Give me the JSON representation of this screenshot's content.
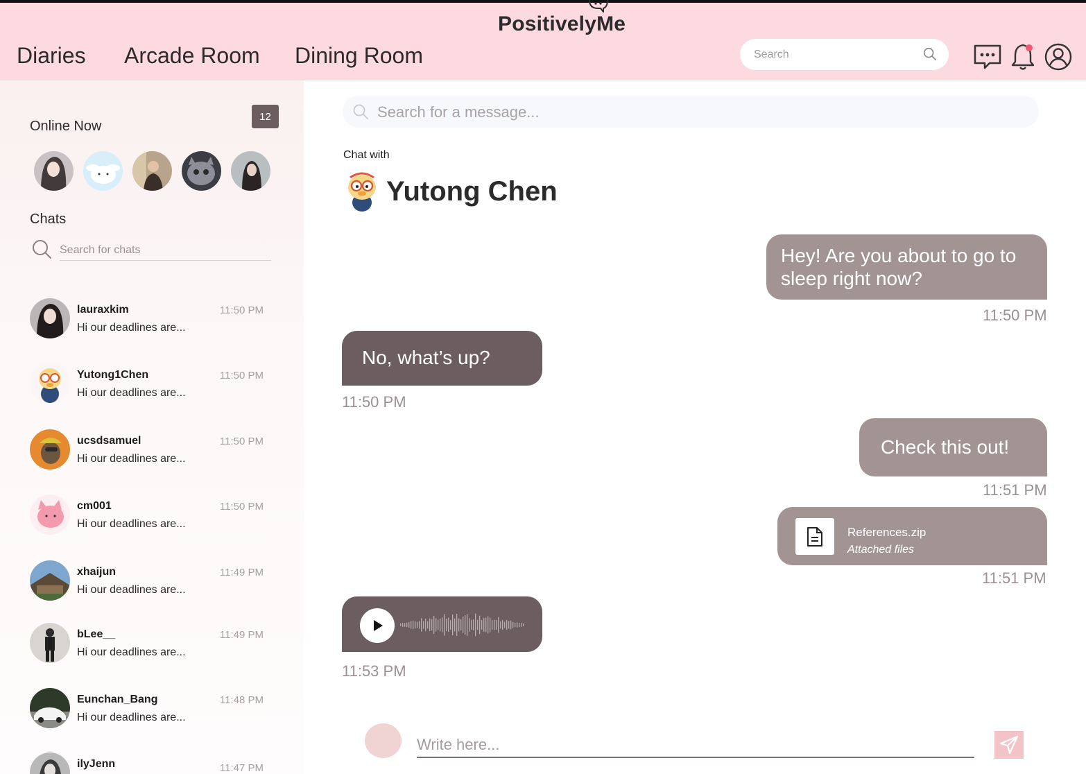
{
  "header": {
    "logo": "PositivelyMe",
    "nav": [
      "Diaries",
      "Arcade Room",
      "Dining Room"
    ],
    "search_placeholder": "Search",
    "icons": [
      "chat-bubble-icon",
      "bell-icon",
      "user-profile-icon"
    ],
    "accent_color": "#fdd9e0"
  },
  "sidebar": {
    "online_title": "Online Now",
    "online_count": "12",
    "online_avatars": [
      "avatar-1",
      "avatar-2",
      "avatar-3",
      "avatar-4",
      "avatar-5"
    ],
    "chats_title": "Chats",
    "search_placeholder": "Search for chats",
    "chats": [
      {
        "name": "lauraxkim",
        "preview": "Hi our deadlines are...",
        "time": "11:50 PM"
      },
      {
        "name": "Yutong1Chen",
        "preview": "Hi our deadlines are...",
        "time": "11:50 PM"
      },
      {
        "name": "ucsdsamuel",
        "preview": "Hi our deadlines are...",
        "time": "11:50 PM"
      },
      {
        "name": "cm001",
        "preview": "Hi our deadlines are...",
        "time": "11:50 PM"
      },
      {
        "name": "xhaijun",
        "preview": "Hi our deadlines are...",
        "time": "11:49 PM"
      },
      {
        "name": "bLee__",
        "preview": "Hi our deadlines are...",
        "time": "11:49 PM"
      },
      {
        "name": "Eunchan_Bang",
        "preview": "Hi our deadlines are...",
        "time": "11:48 PM"
      },
      {
        "name": "ilyJenn",
        "preview": "",
        "time": "11:47 PM"
      }
    ]
  },
  "main": {
    "search_placeholder": "Search for a message...",
    "chat_with_label": "Chat with",
    "chat_with_name": "Yutong Chen",
    "messages": [
      {
        "type": "sent",
        "text": "Hey! Are you about to go to sleep right now?",
        "time": "11:50 PM"
      },
      {
        "type": "received",
        "text": "No, what’s up?",
        "time": "11:50 PM"
      },
      {
        "type": "sent",
        "text": "Check this out!",
        "time": "11:51 PM"
      },
      {
        "type": "file",
        "file_name": "References.zip",
        "file_sub": "Attached files",
        "time": "11:51 PM"
      },
      {
        "type": "audio",
        "time": "11:53 PM"
      }
    ],
    "composer_placeholder": "Write here...",
    "colors": {
      "sent_bubble": "#a39494",
      "received_bubble": "#6b5d60"
    }
  }
}
